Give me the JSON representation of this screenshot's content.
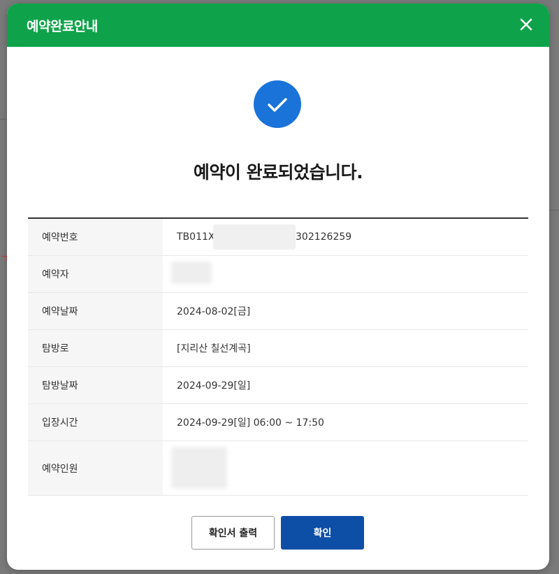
{
  "modal": {
    "title": "예약완료안내",
    "heading": "예약이 완료되었습니다."
  },
  "reservation": [
    {
      "label": "예약번호",
      "value": "TB011X",
      "value_suffix": "302126259"
    },
    {
      "label": "예약자",
      "value": ""
    },
    {
      "label": "예약날짜",
      "value": "2024-08-02[금]"
    },
    {
      "label": "탐방로",
      "value": "[지리산 칠선계곡]"
    },
    {
      "label": "탐방날짜",
      "value": "2024-09-29[일]"
    },
    {
      "label": "입장시간",
      "value": "2024-09-29[일] 06:00 ~ 17:50"
    },
    {
      "label": "예약인원",
      "value": ""
    }
  ],
  "buttons": {
    "print_label": "확인서 출력",
    "confirm_label": "확인"
  },
  "colors": {
    "header": "#0ea34a",
    "check_circle": "#1a73d9",
    "confirm_button": "#0d4ea6"
  },
  "icons": {
    "close": "close-icon",
    "check": "check-icon"
  }
}
